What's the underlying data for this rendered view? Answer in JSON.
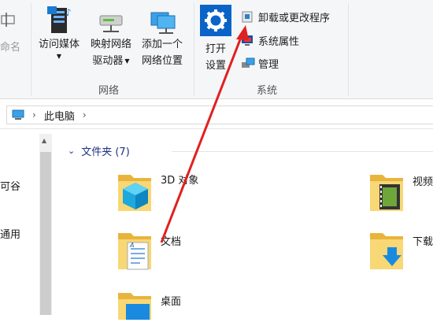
{
  "ribbon": {
    "left_partial_label": "命名",
    "network_group": {
      "label": "网络",
      "buttons": [
        {
          "label_lines": [
            "访问媒体"
          ],
          "has_dropdown": true,
          "icon": "media-server-icon"
        },
        {
          "label_lines": [
            "映射网络",
            "驱动器"
          ],
          "has_dropdown": true,
          "icon": "map-drive-icon"
        },
        {
          "label_lines": [
            "添加一个",
            "网络位置"
          ],
          "has_dropdown": false,
          "icon": "network-location-icon"
        }
      ]
    },
    "system_group": {
      "label": "系统",
      "open_settings": {
        "label_lines": [
          "打开",
          "设置"
        ],
        "icon": "settings-gear-icon"
      },
      "small_buttons": [
        {
          "label": "卸载或更改程序",
          "icon": "uninstall-program-icon"
        },
        {
          "label": "系统属性",
          "icon": "system-properties-icon"
        },
        {
          "label": "管理",
          "icon": "computer-management-icon"
        }
      ]
    }
  },
  "address_bar": {
    "breadcrumb": [
      "此电脑"
    ]
  },
  "nav_pane": {
    "partial_items": [
      "可谷",
      "通用"
    ]
  },
  "content": {
    "section_title": "文件夹 (7)",
    "folders": [
      {
        "name": "3D 对象",
        "icon": "3d-objects-folder-icon"
      },
      {
        "name": "视频",
        "icon": "videos-folder-icon"
      },
      {
        "name": "文档",
        "icon": "documents-folder-icon"
      },
      {
        "name": "下载",
        "icon": "downloads-folder-icon"
      },
      {
        "name": "桌面",
        "icon": "desktop-folder-icon"
      }
    ]
  },
  "annotation": {
    "color": "#e02020"
  },
  "colors": {
    "accent": "#0a64c8",
    "folder": "#f8d775",
    "folder_dark": "#e8b43c"
  }
}
